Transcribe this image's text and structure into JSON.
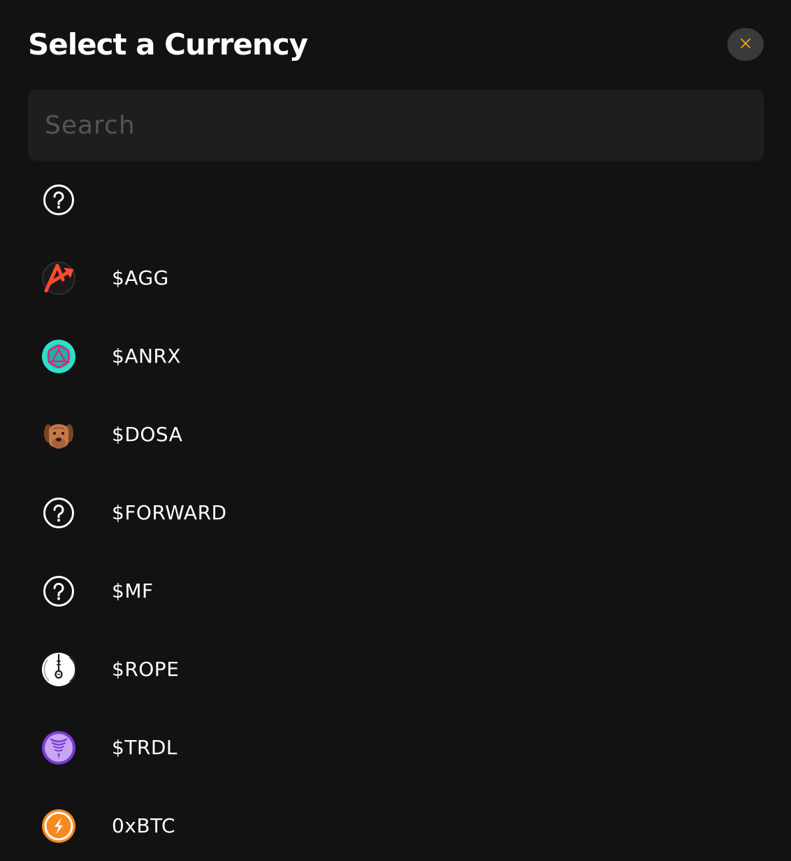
{
  "modal": {
    "title": "Select a Currency",
    "accent_color": "#f0a818"
  },
  "close_button": {
    "icon": "close-icon"
  },
  "search": {
    "placeholder": "Search",
    "value": ""
  },
  "currencies": [
    {
      "symbol": "",
      "icon": "unknown-token-icon"
    },
    {
      "symbol": "$AGG",
      "icon": "agg-token-icon"
    },
    {
      "symbol": "$ANRX",
      "icon": "anrx-token-icon"
    },
    {
      "symbol": "$DOSA",
      "icon": "dosa-token-icon"
    },
    {
      "symbol": "$FORWARD",
      "icon": "unknown-token-icon"
    },
    {
      "symbol": "$MF",
      "icon": "unknown-token-icon"
    },
    {
      "symbol": "$ROPE",
      "icon": "rope-token-icon"
    },
    {
      "symbol": "$TRDL",
      "icon": "trdl-token-icon"
    },
    {
      "symbol": "0xBTC",
      "icon": "0xbtc-token-icon"
    }
  ]
}
